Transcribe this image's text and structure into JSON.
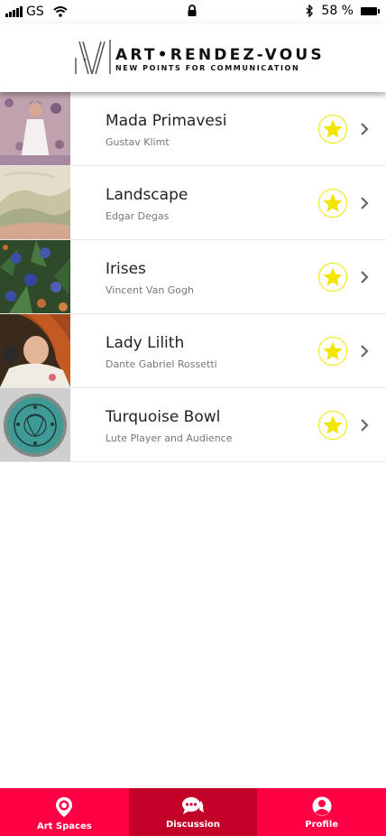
{
  "status_bar": {
    "carrier": "GS",
    "battery": "58 %",
    "icons": [
      "signal-icon",
      "wifi-icon",
      "lock-icon",
      "bluetooth-icon",
      "battery-icon"
    ]
  },
  "header": {
    "title": "ART•RENDEZ-VOUS",
    "subtitle": "NEW POINTS FOR COMMUNICATION"
  },
  "artworks": [
    {
      "title": "Mada Primavesi",
      "artist": "Gustav Klimt",
      "favorite": true
    },
    {
      "title": "Landscape",
      "artist": "Edgar Degas",
      "favorite": true
    },
    {
      "title": "Irises",
      "artist": "Vincent Van Gogh",
      "favorite": true
    },
    {
      "title": "Lady Lilith",
      "artist": "Dante Gabriel Rossetti",
      "favorite": true
    },
    {
      "title": "Turquoise Bowl",
      "artist": "Lute Player and Audience",
      "favorite": true
    }
  ],
  "bottom_nav": {
    "items": [
      {
        "label": "Art Spaces",
        "icon": "location-pin-icon",
        "active": false
      },
      {
        "label": "Discussion",
        "icon": "chat-bubbles-icon",
        "active": true
      },
      {
        "label": "Profile",
        "icon": "user-icon",
        "active": false
      }
    ]
  },
  "colors": {
    "accent": "#ff0044",
    "accent_active": "#c30027",
    "star": "#f2e500"
  }
}
